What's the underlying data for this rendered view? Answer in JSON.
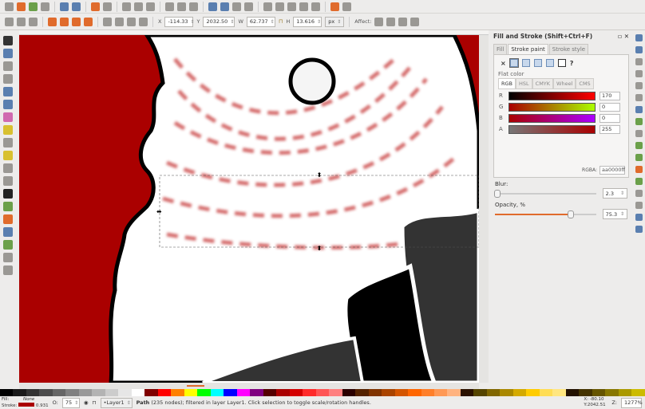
{
  "toolbar": {
    "x_label": "X",
    "x": "-114.33",
    "y_label": "Y",
    "y": "2032.50",
    "w_label": "W",
    "w": "62.737",
    "h_label": "H",
    "h": "13.616",
    "unit": "px",
    "affect_label": "Affect:"
  },
  "panel": {
    "title": "Fill and Stroke (Shift+Ctrl+F)",
    "tabs": [
      "Fill",
      "Stroke paint",
      "Stroke style"
    ],
    "unset": "×",
    "unknown": "?",
    "flat_color": "Flat color",
    "color_tabs": [
      "RGB",
      "HSL",
      "CMYK",
      "Wheel",
      "CMS"
    ],
    "channels": [
      {
        "label": "R",
        "value": "170"
      },
      {
        "label": "G",
        "value": "0"
      },
      {
        "label": "B",
        "value": "0"
      },
      {
        "label": "A",
        "value": "255"
      }
    ],
    "rgba_label": "RGBA:",
    "rgba": "aa0000ff",
    "blur_label": "Blur:",
    "blur": "2.3",
    "blur_fraction": 0.023,
    "opacity_label": "Opacity, %",
    "opacity": "75.3",
    "opacity_fraction": 0.753
  },
  "status": {
    "fill_label": "Fill:",
    "fill_value": "None",
    "stroke_label": "Stroke:",
    "stroke_width": "0.931",
    "stroke_color": "#aa0000",
    "o_label": "O:",
    "opacity": "75",
    "layer": "•Layer1",
    "message_bold": "Path",
    "message": " (235 nodes); filtered in layer Layer1. Click selection to toggle scale/rotation handles.",
    "x_label": "X:",
    "x": "-80.10",
    "y_label": "Y:",
    "y": "2042.51",
    "z_label": "Z:",
    "zoom": "1277%"
  },
  "canvas": {
    "bg_color": "#aa0000"
  }
}
